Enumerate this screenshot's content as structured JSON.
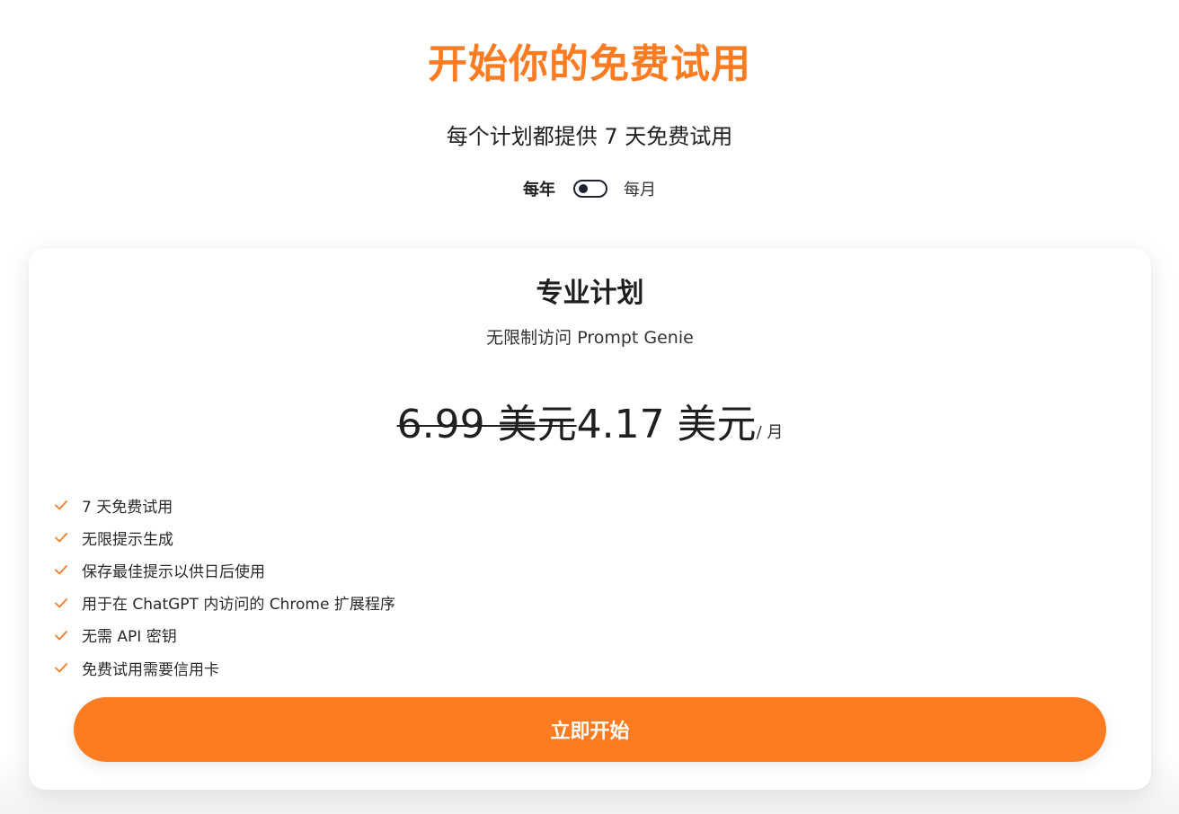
{
  "header": {
    "title": "开始你的免费试用",
    "subtitle": "每个计划都提供 7 天免费试用"
  },
  "billing": {
    "yearly_label": "每年",
    "monthly_label": "每月",
    "toggle_state": "yearly"
  },
  "plan": {
    "name": "专业计划",
    "description": "无限制访问 Prompt Genie",
    "old_price": "6.99 美元",
    "new_price": "4.17 美元",
    "period": "/ 月",
    "features": [
      "7 天免费试用",
      "无限提示生成",
      "保存最佳提示以供日后使用",
      "用于在 ChatGPT 内访问的 Chrome 扩展程序",
      "无需 API 密钥",
      "免费试用需要信用卡"
    ],
    "cta_label": "立即开始"
  },
  "colors": {
    "accent": "#fd7b21",
    "toggle": "#1e2230",
    "text": "#1f1f1f"
  }
}
